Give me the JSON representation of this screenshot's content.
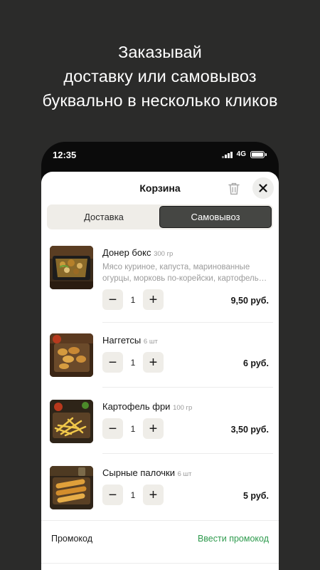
{
  "headline": {
    "line1": "Заказывай",
    "line2": "доставку или самовывоз",
    "line3": "буквально в несколько кликов"
  },
  "status_bar": {
    "time": "12:35",
    "network": "4G"
  },
  "cart": {
    "title": "Корзина",
    "tabs": [
      {
        "label": "Доставка",
        "active": false
      },
      {
        "label": "Самовывоз",
        "active": true
      }
    ],
    "items": [
      {
        "name": "Донер бокс",
        "size": "300 гр",
        "description": "Мясо куриное, капуста, маринованные огурцы, морковь по-корейски, картофель…",
        "quantity": "1",
        "price": "9,50 руб.",
        "image": "doner-box-photo"
      },
      {
        "name": "Наггетсы",
        "size": "6 шт",
        "quantity": "1",
        "price": "6 руб.",
        "image": "nuggets-photo"
      },
      {
        "name": "Картофель фри",
        "size": "100 гр",
        "quantity": "1",
        "price": "3,50 руб.",
        "image": "fries-photo"
      },
      {
        "name": "Сырные палочки",
        "size": "6 шт",
        "quantity": "1",
        "price": "5 руб.",
        "image": "cheese-sticks-photo"
      }
    ],
    "stepper": {
      "minus": "−",
      "plus": "+"
    },
    "promo": {
      "label": "Промокод",
      "action": "Ввести промокод"
    }
  },
  "colors": {
    "background": "#2b2b2a",
    "accent_green": "#2f9b4e",
    "segment_active": "#454643",
    "chip": "#efede8"
  }
}
